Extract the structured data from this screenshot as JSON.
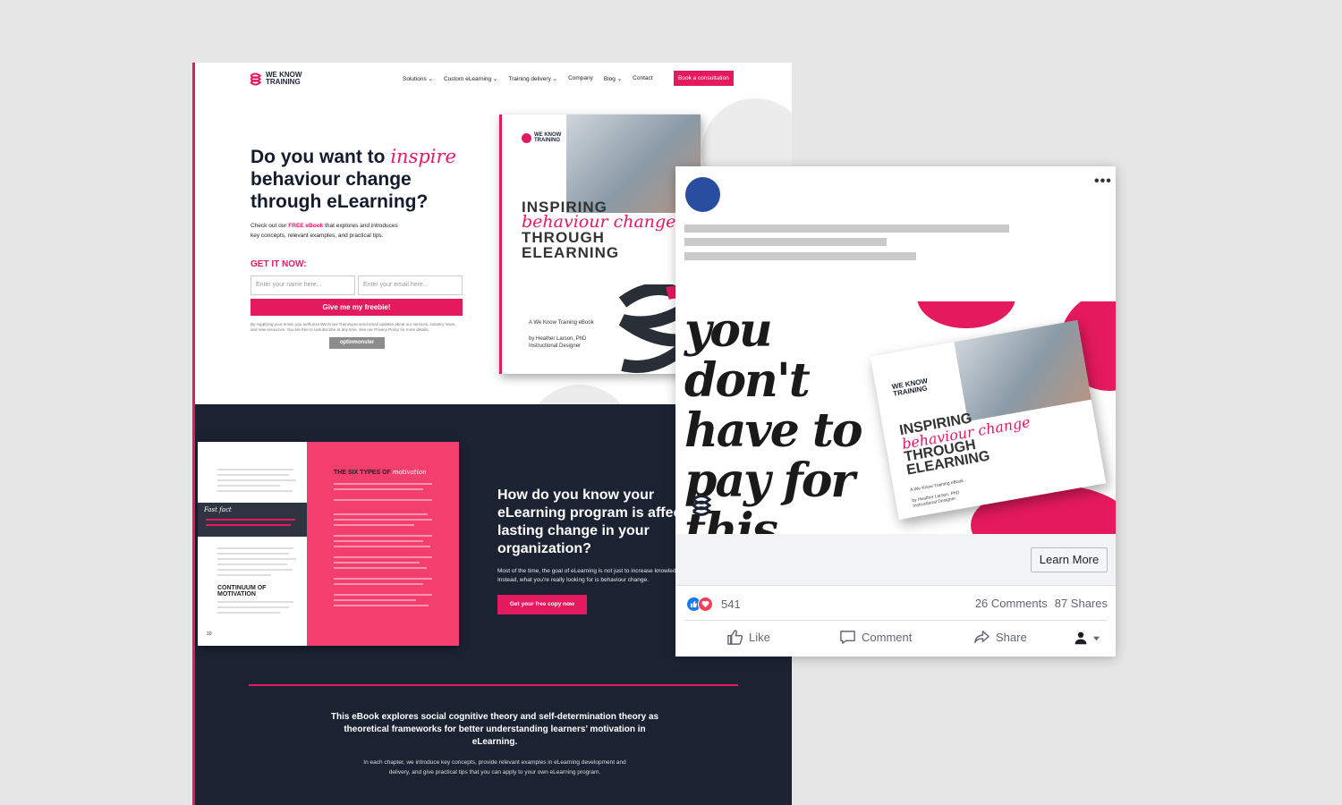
{
  "landing": {
    "brand": {
      "line1": "WE KNOW",
      "line2": "TRAINING"
    },
    "nav": [
      "Solutions ⌄",
      "Custom eLearning ⌄",
      "Training delivery ⌄",
      "Company",
      "Blog ⌄",
      "Contact"
    ],
    "book_consultation": "Book a consultation",
    "hero": {
      "title_pre": "Do you want to ",
      "title_accent": "inspire",
      "title_post": " behaviour change through eLearning?",
      "intro_pre": "Check out our ",
      "intro_free": "FREE eBook",
      "intro_post": " that explores and introduces key concepts, relevant examples, and practical tips.",
      "get_it": "GET IT NOW:",
      "name_placeholder": "Enter your name here...",
      "email_placeholder": "Enter your email here...",
      "submit": "Give me my freebie!",
      "fine_print": "By supplying your email, you authorize We Know Training to send email updates about our services, industry news, and new resources. You are free to unsubscribe at any time. See our Privacy Policy for more details.",
      "optin_badge": "optinmonster"
    },
    "ebook": {
      "brand_line1": "WE KNOW",
      "brand_line2": "TRAINING",
      "title_line1": "INSPIRING",
      "title_script": "behaviour change",
      "title_line2": "THROUGH",
      "title_line3": "ELEARNING",
      "subtitle": "A We Know Training eBook",
      "author": "by Heather Larson, PhD",
      "author_role": "Instructional Designer"
    },
    "spread": {
      "six_types_pre": "THE SIX TYPES OF ",
      "six_types_accent": "motivation",
      "fact_label": "Fast fact",
      "continuum": "CONTINUUM OF MOTIVATION",
      "page_no": "10"
    },
    "dark": {
      "heading": "How do you know your eLearning program is affecting lasting change in your organization?",
      "body": "Most of the time, the goal of eLearning is not just to increase knowledge. Instead, what you're really looking for is behaviour change.",
      "cta": "Get your free copy now",
      "statement": "This eBook explores social cognitive theory and self-determination theory as theoretical frameworks for better understanding learners’ motivation in eLearning.",
      "detail": "In each chapter, we introduce key concepts, provide relevant examples in eLearning development and delivery, and give practical tips that you can apply to your own eLearning program."
    }
  },
  "facebook_ad": {
    "more_icon": "more-horizontal-icon",
    "image": {
      "script_text": "you don't have to pay for this",
      "book_brand": "WE KNOW TRAINING",
      "book_title_line1": "INSPIRING",
      "book_title_script": "behaviour change",
      "book_title_line2": "THROUGH",
      "book_title_line3": "ELEARNING",
      "book_subtitle": "A We Know Training eBook",
      "book_author": "by Heather Larson, PhD Instructional Designer"
    },
    "cta": "Learn More",
    "reaction_count": "541",
    "comments": "26 Comments",
    "shares": "87 Shares",
    "actions": {
      "like": "Like",
      "comment": "Comment",
      "share": "Share"
    },
    "colors": {
      "brand_pink": "#e5195e",
      "navy": "#1b2333",
      "fb_blue": "#1877f2",
      "love_red": "#f33e58"
    }
  }
}
